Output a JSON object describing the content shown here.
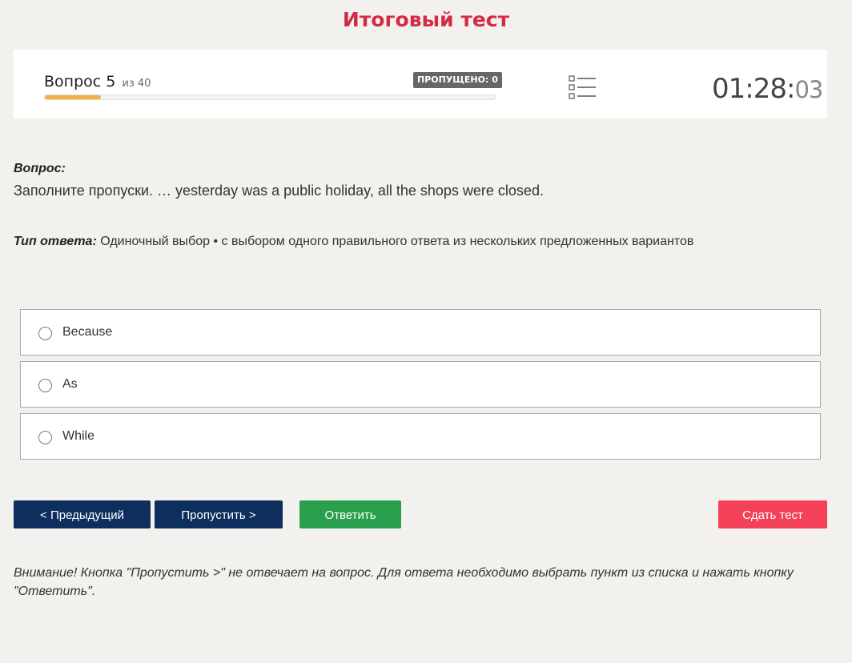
{
  "page": {
    "title": "Итоговый тест"
  },
  "status": {
    "question_label": "Вопрос 5",
    "question_total": "из 40",
    "skipped_badge": "ПРОПУЩЕНО: 0",
    "progress": 0.125,
    "timer_main": "01:28:",
    "timer_seconds": "03",
    "list_icon": "list-icon",
    "progress_color": "#f2b042"
  },
  "question": {
    "heading": "Вопрос:",
    "text": "Заполните пропуски. … yesterday was a public holiday, all the shops were closed.",
    "answer_type_label": "Тип ответа:",
    "answer_type_value": "Одиночный выбор • с выбором одного правильного ответа из нескольких предложенных вариантов"
  },
  "options": [
    {
      "label": "Because"
    },
    {
      "label": "As"
    },
    {
      "label": "While"
    }
  ],
  "buttons": {
    "prev": "< Предыдущий",
    "skip": "Пропустить >",
    "answer": "Ответить",
    "submit": "Сдать тест"
  },
  "colors": {
    "title": "#d42a45",
    "nav_button": "#0e2f5e",
    "answer_button": "#2aa04f",
    "submit_button": "#f44058"
  },
  "notice": {
    "text": "Внимание! Кнопка \"Пропустить >\" не отвечает на вопрос. Для ответа необходимо выбрать пункт из списка и нажать кнопку \"Ответить\"."
  }
}
